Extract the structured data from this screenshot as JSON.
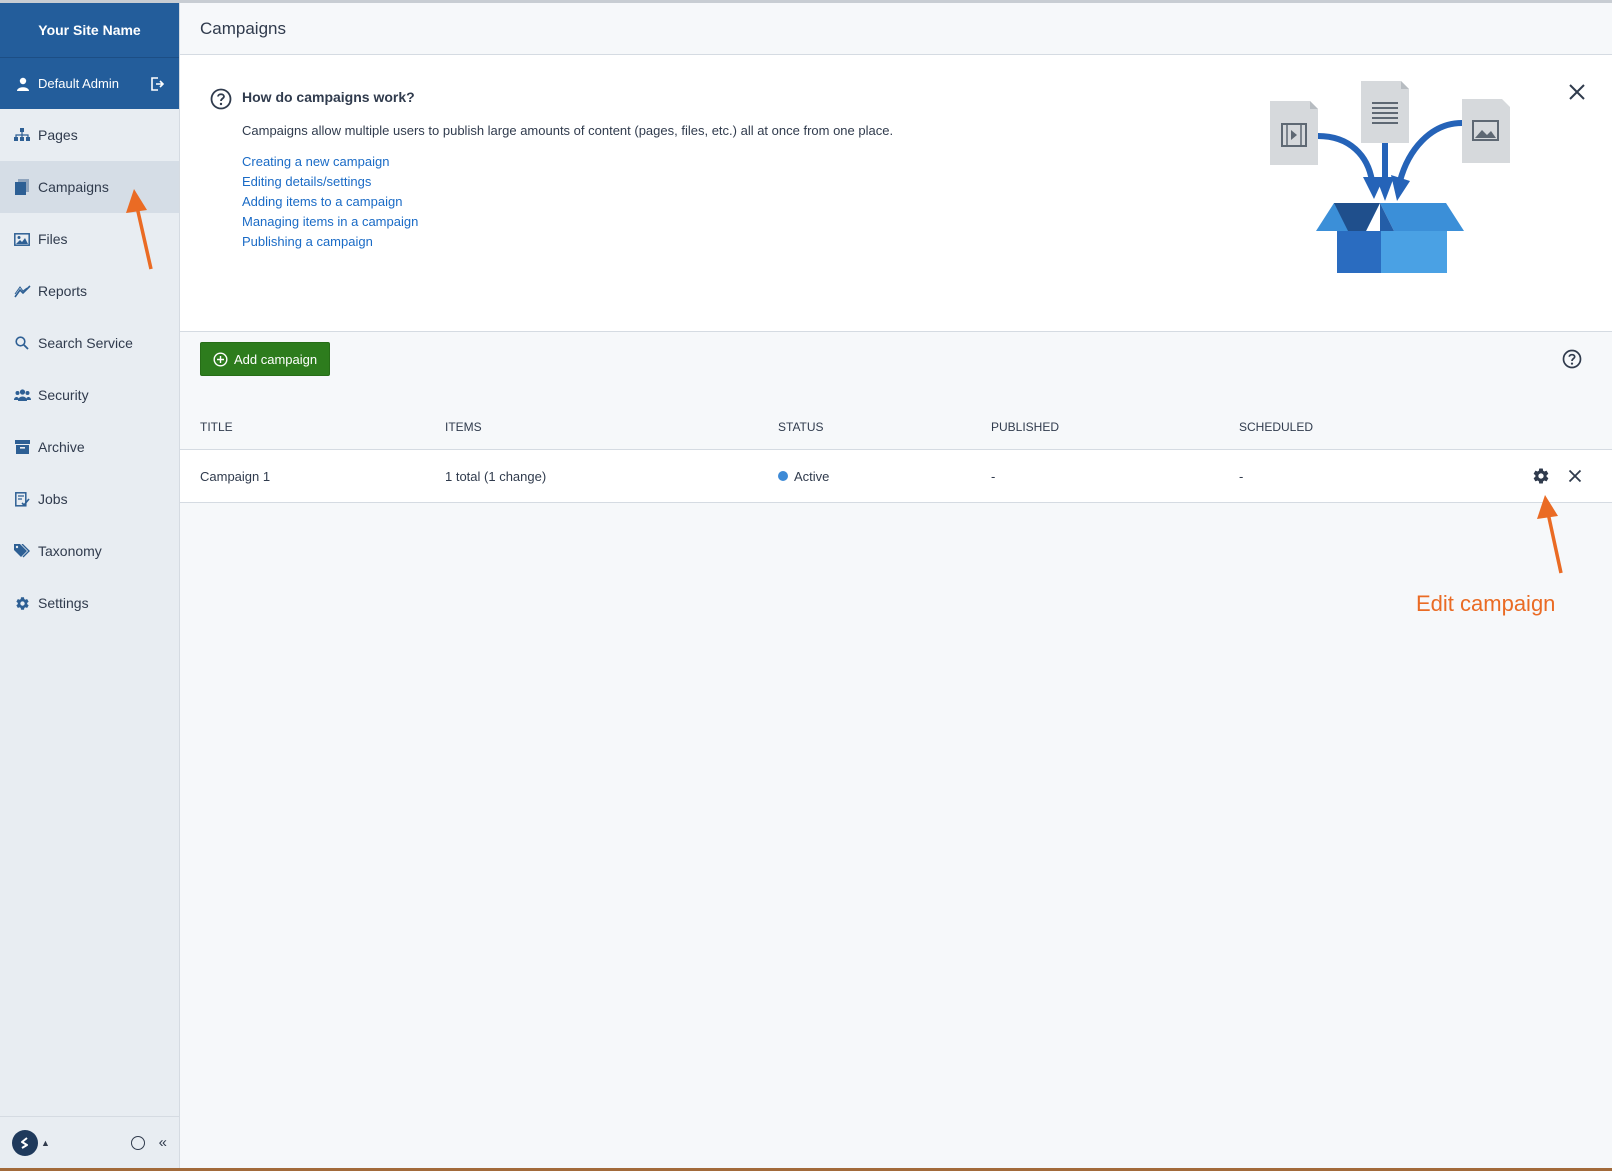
{
  "sidebar": {
    "site_name": "Your Site Name",
    "user_name": "Default Admin",
    "items": [
      {
        "label": "Pages",
        "icon": "sitemap-icon"
      },
      {
        "label": "Campaigns",
        "icon": "campaigns-icon",
        "active": true
      },
      {
        "label": "Files",
        "icon": "image-icon"
      },
      {
        "label": "Reports",
        "icon": "chart-line-icon"
      },
      {
        "label": "Search Service",
        "icon": "search-icon"
      },
      {
        "label": "Security",
        "icon": "users-icon"
      },
      {
        "label": "Archive",
        "icon": "archive-icon"
      },
      {
        "label": "Jobs",
        "icon": "jobs-icon"
      },
      {
        "label": "Taxonomy",
        "icon": "tags-icon"
      },
      {
        "label": "Settings",
        "icon": "gear-icon"
      }
    ],
    "collapse_glyph": "«"
  },
  "header": {
    "title": "Campaigns"
  },
  "help": {
    "title": "How do campaigns work?",
    "description": "Campaigns allow multiple users to publish large amounts of content (pages, files, etc.) all at once from one place.",
    "links": [
      "Creating a new campaign",
      "Editing details/settings",
      "Adding items to a campaign",
      "Managing items in a campaign",
      "Publishing a campaign"
    ]
  },
  "actions": {
    "add_label": "Add campaign"
  },
  "table": {
    "columns": [
      "TITLE",
      "ITEMS",
      "STATUS",
      "PUBLISHED",
      "SCHEDULED"
    ],
    "rows": [
      {
        "title": "Campaign 1",
        "items": "1 total (1 change)",
        "status": "Active",
        "published": "-",
        "scheduled": "-"
      }
    ]
  },
  "annotation": {
    "edit_label": "Edit campaign"
  },
  "colors": {
    "brand": "#235d9b",
    "add_button": "#2d7c1d",
    "link": "#1a6bc6",
    "annotation": "#ea6b24",
    "status_active": "#3d8ad6"
  }
}
